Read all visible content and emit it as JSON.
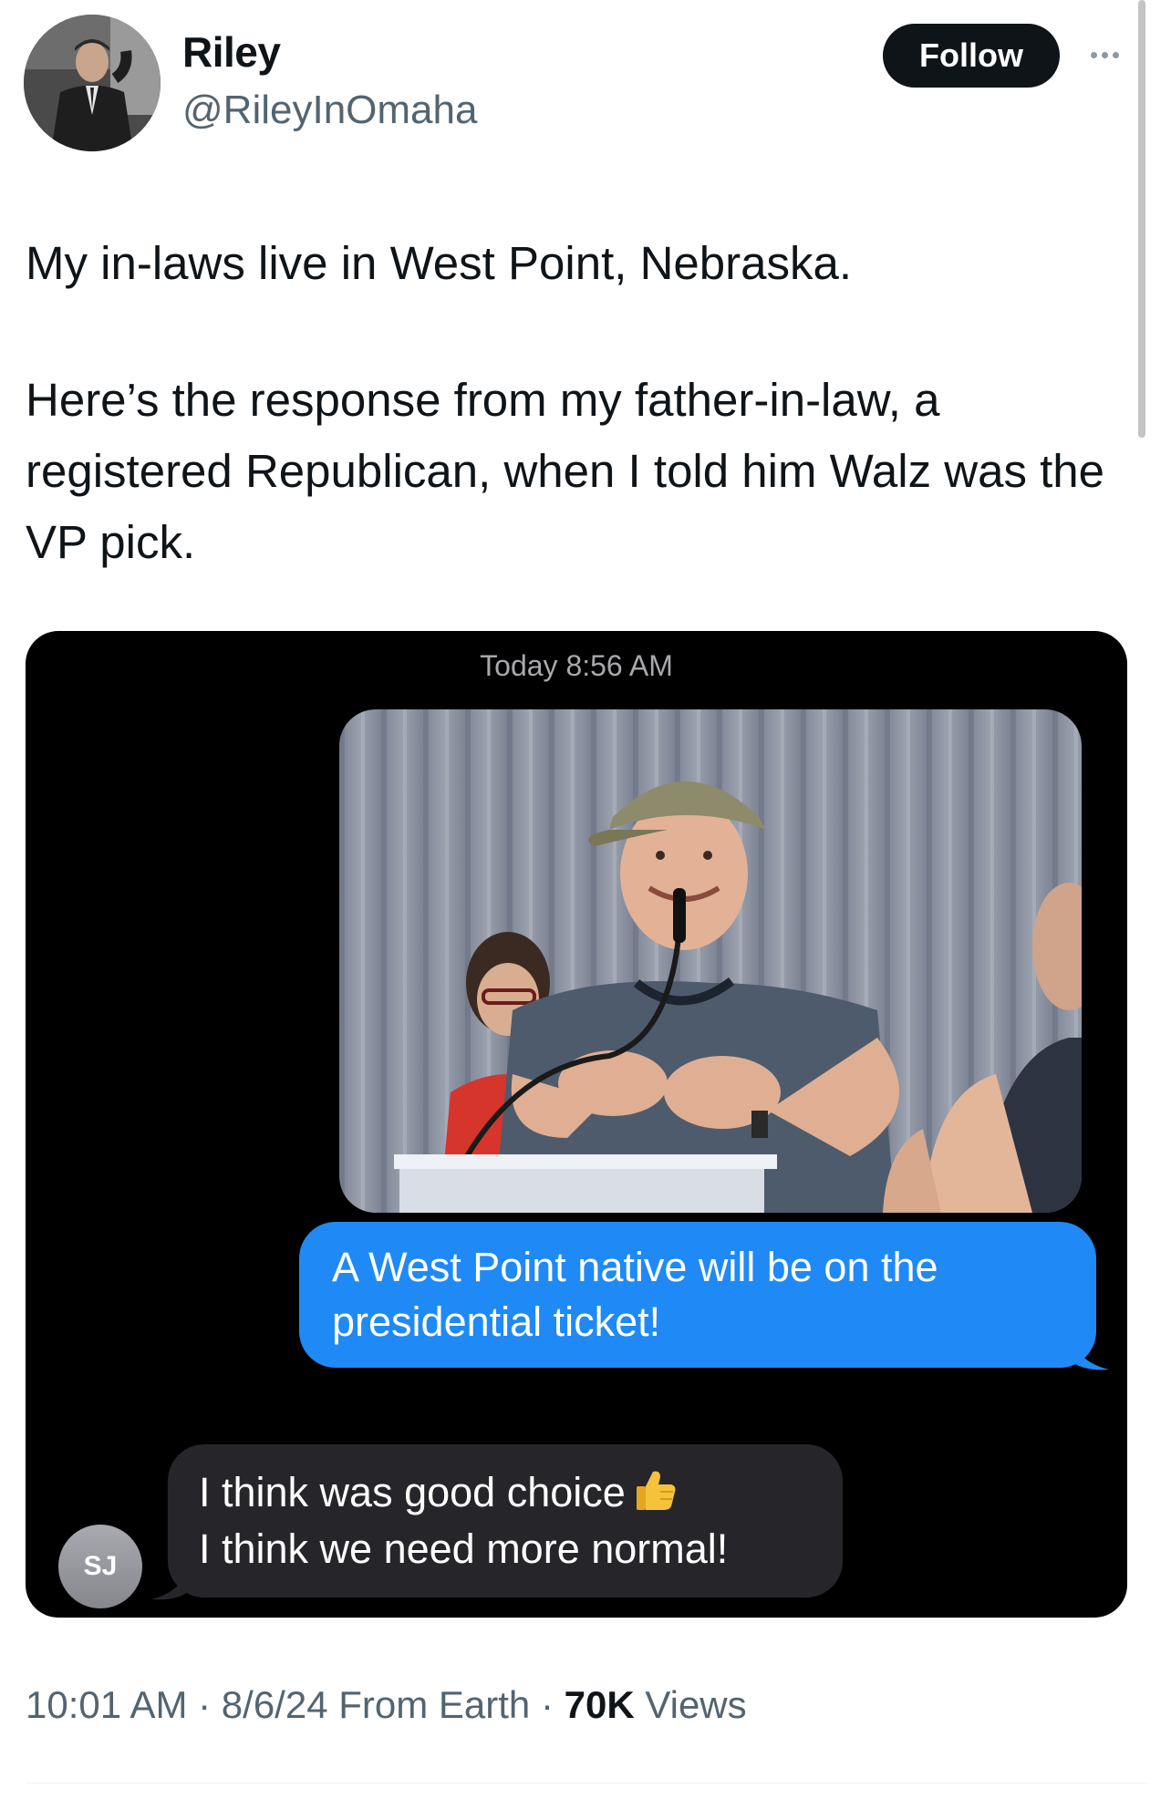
{
  "author": {
    "name": "Riley",
    "handle": "@RileyInOmaha"
  },
  "follow_label": "Follow",
  "tweet": {
    "paragraph1": "My in-laws live in West Point, Nebraska.",
    "paragraph2": "Here’s the response from my father-in-law, a registered Republican, when I told him Walz was the VP pick."
  },
  "messages": {
    "timestamp": "Today 8:56 AM",
    "outgoing": "A West Point native will be on the presidential ticket!",
    "incoming_line1": "I think was good choice",
    "incoming_line2": "I think we need more normal!",
    "sender_initials": "SJ",
    "emoji_icon": "thumbs-up-icon"
  },
  "footer": {
    "time": "10:01 AM",
    "date": "8/6/24",
    "source": "From Earth",
    "views_count": "70K",
    "views_label": "Views"
  },
  "colors": {
    "outgoing_bubble": "#1f8af5",
    "incoming_bubble": "#26262a",
    "follow_button": "#0f1419",
    "secondary_text": "#536471"
  }
}
